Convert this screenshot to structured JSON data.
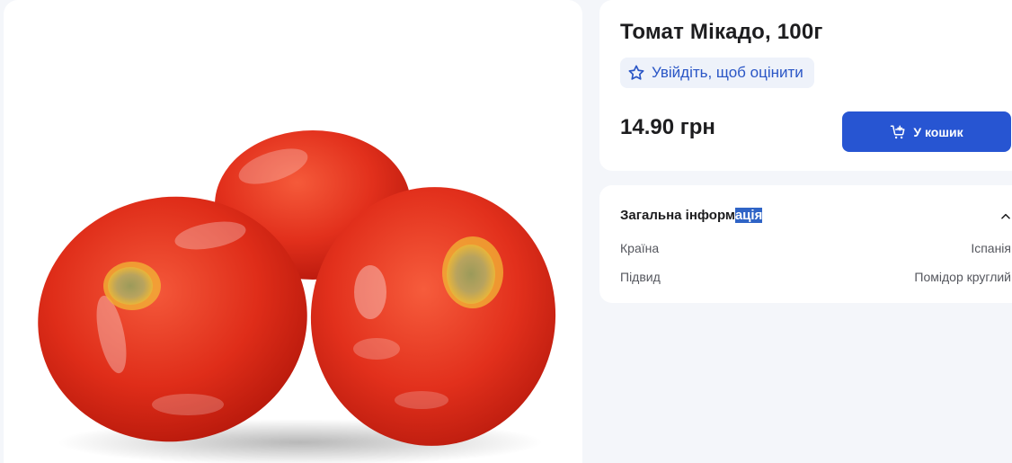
{
  "product": {
    "title": "Томат Мікадо, 100г",
    "rating_prompt": "Увійдіть, щоб оцінити",
    "price": "14.90 грн",
    "add_to_cart_label": "У кошик",
    "image_icon": "tomato-photo"
  },
  "details": {
    "section_title_start": "Загальна інформ",
    "section_title_selected": "ація",
    "rows": [
      {
        "label": "Країна",
        "value": "Іспанія"
      },
      {
        "label": "Підвид",
        "value": "Помідор круглий"
      }
    ]
  },
  "icons": {
    "rating": "star-outline-icon",
    "cart": "cart-plus-icon",
    "collapse": "chevron-up-icon"
  },
  "colors": {
    "accent": "#2755d2",
    "link": "#2a56c6",
    "chip_bg": "#eef2fa",
    "page_bg": "#f4f6fa",
    "selection": "#2f64c6"
  }
}
